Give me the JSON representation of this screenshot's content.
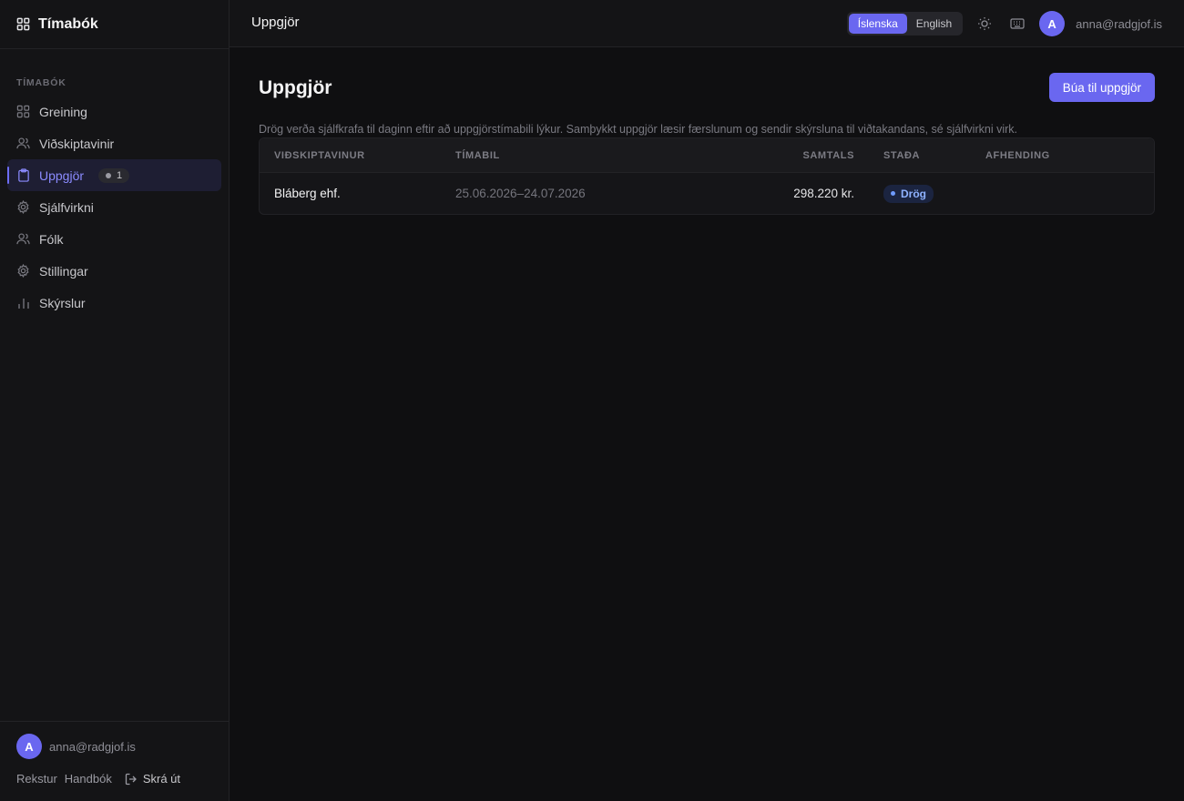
{
  "app": {
    "title": "Tímabók"
  },
  "sidebar": {
    "section_label": "TÍMABÓK",
    "items": [
      {
        "label": "Greining",
        "icon": "grid-icon"
      },
      {
        "label": "Viðskiptavinir",
        "icon": "users-icon"
      },
      {
        "label": "Uppgjör",
        "icon": "clipboard-icon",
        "active": true,
        "badge": "1"
      },
      {
        "label": "Sjálfvirkni",
        "icon": "gear-icon"
      },
      {
        "label": "Fólk",
        "icon": "users-icon"
      },
      {
        "label": "Stillingar",
        "icon": "gear-icon"
      },
      {
        "label": "Skýrslur",
        "icon": "bar-chart-icon"
      }
    ],
    "user": {
      "avatar": "A",
      "email": "anna@radgjof.is"
    },
    "footer": {
      "link1": "Rekstur",
      "link2": "Handbók",
      "logout": "Skrá út"
    }
  },
  "topbar": {
    "title": "Uppgjör",
    "lang": {
      "is": "Íslenska",
      "en": "English",
      "active": "is"
    },
    "user": {
      "avatar": "A",
      "email": "anna@radgjof.is"
    }
  },
  "main": {
    "title": "Uppgjör",
    "create_button": "Búa til uppgjör",
    "description": "Drög verða sjálfkrafa til daginn eftir að uppgjörstímabili lýkur. Samþykkt uppgjör læsir færslunum og sendir skýrsluna til viðtakandans, sé sjálfvirkni virk.",
    "table": {
      "headers": {
        "client": "VIÐSKIPTAVINUR",
        "period": "TÍMABIL",
        "total": "SAMTALS",
        "status": "STAÐA",
        "delivery": "AFHENDING"
      },
      "rows": [
        {
          "client": "Bláberg ehf.",
          "period": "25.06.2026–24.07.2026",
          "total": "298.220 kr.",
          "status": "Drög",
          "delivery": ""
        }
      ]
    }
  },
  "colors": {
    "accent": "#6a67f0",
    "background": "#0f0f11",
    "status_draft": "#8fb2ff"
  }
}
